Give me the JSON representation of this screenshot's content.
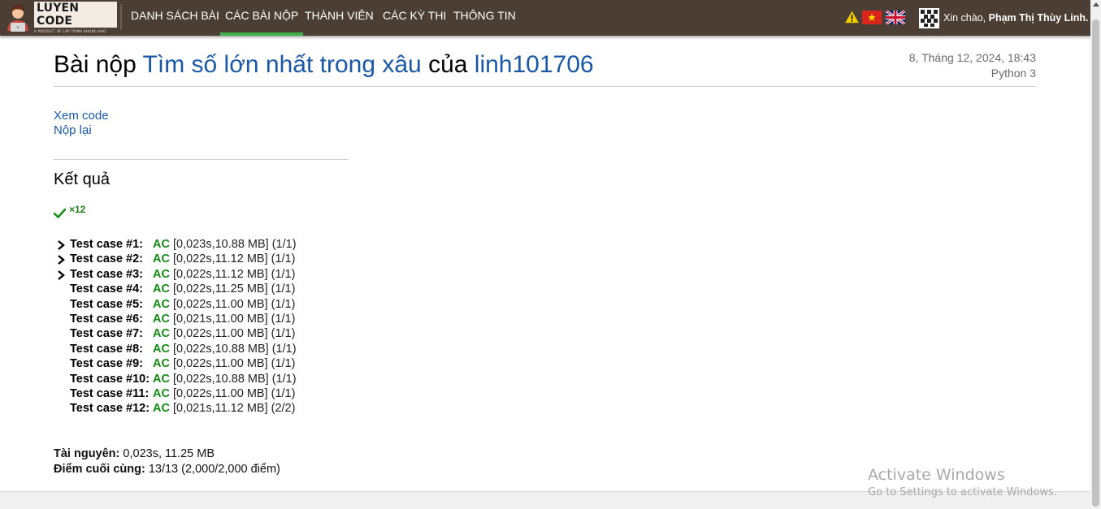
{
  "navbar": {
    "logo_title": "LUYEN CODE",
    "logo_subtitle": "A PRODUCT OF LAP TRINH KHONG KHO",
    "items": [
      {
        "label": "DANH SÁCH BÀI",
        "active": false
      },
      {
        "label": "CÁC BÀI NỘP",
        "active": true
      },
      {
        "label": "THÀNH VIÊN",
        "active": false
      },
      {
        "label": "CÁC KỲ THI",
        "active": false
      },
      {
        "label": "THÔNG TIN",
        "active": false
      }
    ],
    "greeting_prefix": "Xin chào,",
    "user_name": "Phạm Thị Thùy Linh.",
    "icons": [
      "warning-icon",
      "vietnam-flag-icon",
      "uk-flag-icon",
      "user-avatar-icon"
    ],
    "accent_color": "#3fb14f",
    "bar_color": "#4b3f35"
  },
  "submission": {
    "title_prefix": "Bài nộp",
    "problem_name": "Tìm số lớn nhất trong xâu",
    "title_middle": "của",
    "user": "linh101706",
    "date": "8, Tháng 12, 2024, 18:43",
    "language": "Python 3",
    "actions": {
      "view_code": "Xem code",
      "resubmit": "Nộp lại"
    }
  },
  "result": {
    "heading": "Kết quả",
    "ac_count": "×12",
    "cases": [
      {
        "label": "Test case #1:",
        "status": "AC",
        "detail": "[0,023s,10.88 MB]  (1/1)",
        "expandable": true
      },
      {
        "label": "Test case #2:",
        "status": "AC",
        "detail": "[0,022s,11.12 MB]  (1/1)",
        "expandable": true
      },
      {
        "label": "Test case #3:",
        "status": "AC",
        "detail": "[0,022s,11.12 MB]  (1/1)",
        "expandable": true
      },
      {
        "label": "Test case #4:",
        "status": "AC",
        "detail": "[0,022s,11.25 MB]  (1/1)",
        "expandable": false
      },
      {
        "label": "Test case #5:",
        "status": "AC",
        "detail": "[0,022s,11.00 MB]  (1/1)",
        "expandable": false
      },
      {
        "label": "Test case #6:",
        "status": "AC",
        "detail": "[0,021s,11.00 MB]  (1/1)",
        "expandable": false
      },
      {
        "label": "Test case #7:",
        "status": "AC",
        "detail": "[0,022s,11.00 MB]  (1/1)",
        "expandable": false
      },
      {
        "label": "Test case #8:",
        "status": "AC",
        "detail": "[0,022s,10.88 MB]  (1/1)",
        "expandable": false
      },
      {
        "label": "Test case #9:",
        "status": "AC",
        "detail": "[0,022s,11.00 MB]  (1/1)",
        "expandable": false
      },
      {
        "label": "Test case #10:",
        "status": "AC",
        "detail": "[0,022s,10.88 MB]  (1/1)",
        "expandable": false
      },
      {
        "label": "Test case #11:",
        "status": "AC",
        "detail": "[0,022s,11.00 MB]  (1/1)",
        "expandable": false
      },
      {
        "label": "Test case #12:",
        "status": "AC",
        "detail": "[0,021s,11.12 MB]  (2/2)",
        "expandable": false
      }
    ],
    "resources_label": "Tài nguyên:",
    "resources_value": "0,023s, 11.25 MB",
    "final_score_label": "Điểm cuối cùng:",
    "final_score_value": "13/13 (2,000/2,000 điểm)",
    "ac_color": "#148a14"
  },
  "watermark": {
    "title": "Activate Windows",
    "subtitle": "Go to Settings to activate Windows."
  }
}
